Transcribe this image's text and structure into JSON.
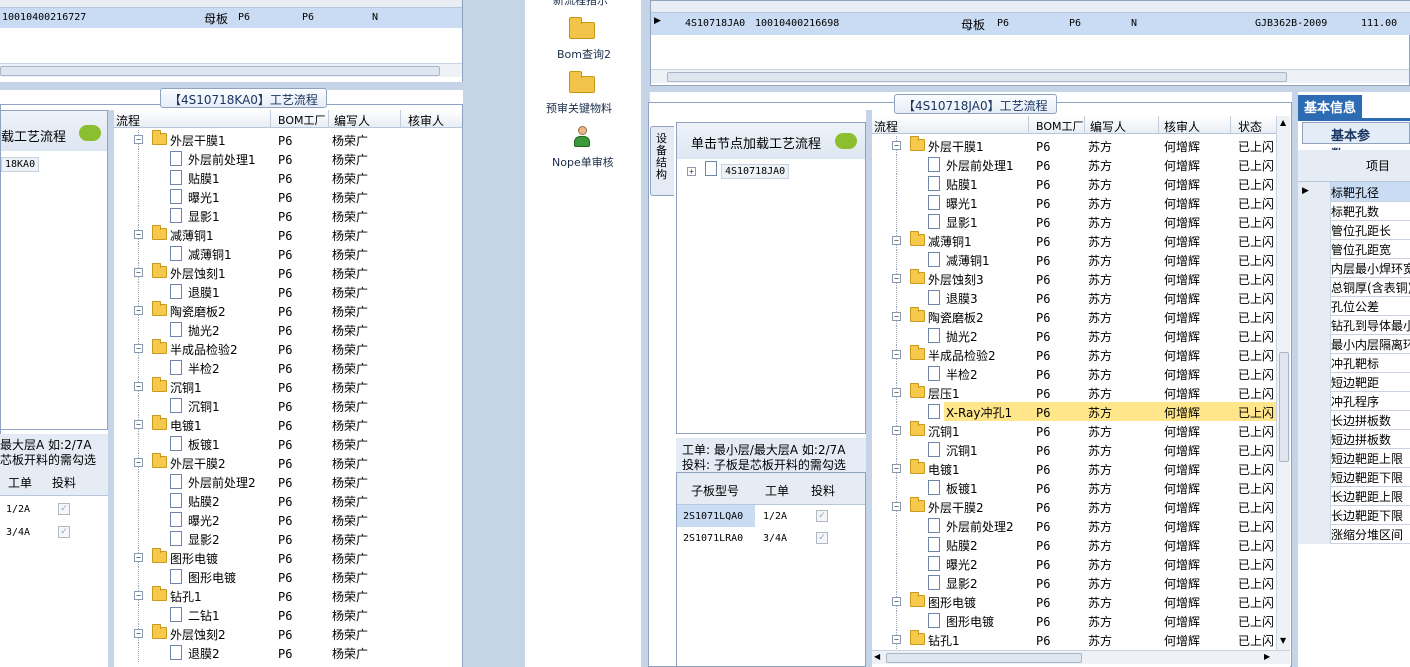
{
  "left_top_grid": {
    "row": {
      "code": "10010400216727",
      "type": "母板",
      "factory": "P6",
      "layer": "P6",
      "flag": "N"
    }
  },
  "left_proc": {
    "title": "【4S10718KA0】工艺流程",
    "side_title": "载工艺流程",
    "side_node": "18KA0",
    "note_line1": "最大层A 如:2/7A",
    "note_line2": "芯板开料的需勾选",
    "mini_headers": [
      "工单",
      "投料"
    ],
    "mini_rows": [
      {
        "order": "1/2A"
      },
      {
        "order": "3/4A"
      }
    ],
    "headers": [
      "流程",
      "BOM工厂",
      "编写人",
      "核审人"
    ],
    "rows": [
      {
        "kind": "folder",
        "label": "外层干膜1",
        "factory": "P6",
        "author": "杨荣广"
      },
      {
        "kind": "doc",
        "label": "外层前处理1",
        "factory": "P6",
        "author": "杨荣广"
      },
      {
        "kind": "doc",
        "label": "贴膜1",
        "factory": "P6",
        "author": "杨荣广"
      },
      {
        "kind": "doc",
        "label": "曝光1",
        "factory": "P6",
        "author": "杨荣广"
      },
      {
        "kind": "doc",
        "label": "显影1",
        "factory": "P6",
        "author": "杨荣广"
      },
      {
        "kind": "folder",
        "label": "减薄铜1",
        "factory": "P6",
        "author": "杨荣广"
      },
      {
        "kind": "doc",
        "label": "减薄铜1",
        "factory": "P6",
        "author": "杨荣广"
      },
      {
        "kind": "folder",
        "label": "外层蚀刻1",
        "factory": "P6",
        "author": "杨荣广"
      },
      {
        "kind": "doc",
        "label": "退膜1",
        "factory": "P6",
        "author": "杨荣广"
      },
      {
        "kind": "folder",
        "label": "陶瓷磨板2",
        "factory": "P6",
        "author": "杨荣广"
      },
      {
        "kind": "doc",
        "label": "抛光2",
        "factory": "P6",
        "author": "杨荣广"
      },
      {
        "kind": "folder",
        "label": "半成品检验2",
        "factory": "P6",
        "author": "杨荣广"
      },
      {
        "kind": "doc",
        "label": "半检2",
        "factory": "P6",
        "author": "杨荣广"
      },
      {
        "kind": "folder",
        "label": "沉铜1",
        "factory": "P6",
        "author": "杨荣广"
      },
      {
        "kind": "doc",
        "label": "沉铜1",
        "factory": "P6",
        "author": "杨荣广"
      },
      {
        "kind": "folder",
        "label": "电镀1",
        "factory": "P6",
        "author": "杨荣广"
      },
      {
        "kind": "doc",
        "label": "板镀1",
        "factory": "P6",
        "author": "杨荣广"
      },
      {
        "kind": "folder",
        "label": "外层干膜2",
        "factory": "P6",
        "author": "杨荣广"
      },
      {
        "kind": "doc",
        "label": "外层前处理2",
        "factory": "P6",
        "author": "杨荣广"
      },
      {
        "kind": "doc",
        "label": "贴膜2",
        "factory": "P6",
        "author": "杨荣广"
      },
      {
        "kind": "doc",
        "label": "曝光2",
        "factory": "P6",
        "author": "杨荣广"
      },
      {
        "kind": "doc",
        "label": "显影2",
        "factory": "P6",
        "author": "杨荣广"
      },
      {
        "kind": "folder",
        "label": "图形电镀",
        "factory": "P6",
        "author": "杨荣广"
      },
      {
        "kind": "doc",
        "label": "图形电镀",
        "factory": "P6",
        "author": "杨荣广"
      },
      {
        "kind": "folder",
        "label": "钻孔1",
        "factory": "P6",
        "author": "杨荣广"
      },
      {
        "kind": "doc",
        "label": "二钻1",
        "factory": "P6",
        "author": "杨荣广"
      },
      {
        "kind": "folder",
        "label": "外层蚀刻2",
        "factory": "P6",
        "author": "杨荣广"
      },
      {
        "kind": "doc",
        "label": "退膜2",
        "factory": "P6",
        "author": "杨荣广"
      }
    ]
  },
  "launcher": {
    "items": [
      {
        "label": "新流程指示",
        "icon": "folder-icon"
      },
      {
        "label": "Bom查询2",
        "icon": "folder-icon"
      },
      {
        "label": "预审关键物料",
        "icon": "folder-icon"
      },
      {
        "label": "Nope单审核",
        "icon": "user-icon"
      }
    ]
  },
  "right_top_grid": {
    "row": {
      "code": "4S10718JA0",
      "num": "10010400216698",
      "type": "母板",
      "factory": "P6",
      "layer": "P6",
      "flag": "N",
      "standard": "GJB362B-2009",
      "value": "111.00"
    }
  },
  "right_proc": {
    "title": "【4S10718JA0】工艺流程",
    "vertical_tab": "设备结构",
    "side_title": "单击节点加载工艺流程",
    "side_node": "4S10718JA0",
    "note_line1": "工单: 最小层/最大层A 如:2/7A",
    "note_line2": "投料: 子板是芯板开料的需勾选",
    "mini_headers": [
      "子板型号",
      "工单",
      "投料"
    ],
    "mini_rows": [
      {
        "model": "2S1071LQA0",
        "order": "1/2A"
      },
      {
        "model": "2S1071LRA0",
        "order": "3/4A"
      }
    ],
    "headers": [
      "流程",
      "BOM工厂",
      "编写人",
      "核审人",
      "状态"
    ],
    "rows": [
      {
        "kind": "folder",
        "label": "外层干膜1",
        "factory": "P6",
        "author": "苏方",
        "reviewer": "何增辉",
        "status": "已上闪"
      },
      {
        "kind": "doc",
        "label": "外层前处理1",
        "factory": "P6",
        "author": "苏方",
        "reviewer": "何增辉",
        "status": "已上闪"
      },
      {
        "kind": "doc",
        "label": "贴膜1",
        "factory": "P6",
        "author": "苏方",
        "reviewer": "何增辉",
        "status": "已上闪"
      },
      {
        "kind": "doc",
        "label": "曝光1",
        "factory": "P6",
        "author": "苏方",
        "reviewer": "何增辉",
        "status": "已上闪"
      },
      {
        "kind": "doc",
        "label": "显影1",
        "factory": "P6",
        "author": "苏方",
        "reviewer": "何增辉",
        "status": "已上闪"
      },
      {
        "kind": "folder",
        "label": "减薄铜1",
        "factory": "P6",
        "author": "苏方",
        "reviewer": "何增辉",
        "status": "已上闪"
      },
      {
        "kind": "doc",
        "label": "减薄铜1",
        "factory": "P6",
        "author": "苏方",
        "reviewer": "何增辉",
        "status": "已上闪"
      },
      {
        "kind": "folder",
        "label": "外层蚀刻3",
        "factory": "P6",
        "author": "苏方",
        "reviewer": "何增辉",
        "status": "已上闪"
      },
      {
        "kind": "doc",
        "label": "退膜3",
        "factory": "P6",
        "author": "苏方",
        "reviewer": "何增辉",
        "status": "已上闪"
      },
      {
        "kind": "folder",
        "label": "陶瓷磨板2",
        "factory": "P6",
        "author": "苏方",
        "reviewer": "何增辉",
        "status": "已上闪"
      },
      {
        "kind": "doc",
        "label": "抛光2",
        "factory": "P6",
        "author": "苏方",
        "reviewer": "何增辉",
        "status": "已上闪"
      },
      {
        "kind": "folder",
        "label": "半成品检验2",
        "factory": "P6",
        "author": "苏方",
        "reviewer": "何增辉",
        "status": "已上闪"
      },
      {
        "kind": "doc",
        "label": "半检2",
        "factory": "P6",
        "author": "苏方",
        "reviewer": "何增辉",
        "status": "已上闪"
      },
      {
        "kind": "folder",
        "label": "层压1",
        "factory": "P6",
        "author": "苏方",
        "reviewer": "何增辉",
        "status": "已上闪"
      },
      {
        "kind": "doc",
        "label": "X-Ray冲孔1",
        "factory": "P6",
        "author": "苏方",
        "reviewer": "何增辉",
        "status": "已上闪",
        "selected": true
      },
      {
        "kind": "folder",
        "label": "沉铜1",
        "factory": "P6",
        "author": "苏方",
        "reviewer": "何增辉",
        "status": "已上闪"
      },
      {
        "kind": "doc",
        "label": "沉铜1",
        "factory": "P6",
        "author": "苏方",
        "reviewer": "何增辉",
        "status": "已上闪"
      },
      {
        "kind": "folder",
        "label": "电镀1",
        "factory": "P6",
        "author": "苏方",
        "reviewer": "何增辉",
        "status": "已上闪"
      },
      {
        "kind": "doc",
        "label": "板镀1",
        "factory": "P6",
        "author": "苏方",
        "reviewer": "何增辉",
        "status": "已上闪"
      },
      {
        "kind": "folder",
        "label": "外层干膜2",
        "factory": "P6",
        "author": "苏方",
        "reviewer": "何增辉",
        "status": "已上闪"
      },
      {
        "kind": "doc",
        "label": "外层前处理2",
        "factory": "P6",
        "author": "苏方",
        "reviewer": "何增辉",
        "status": "已上闪"
      },
      {
        "kind": "doc",
        "label": "贴膜2",
        "factory": "P6",
        "author": "苏方",
        "reviewer": "何增辉",
        "status": "已上闪"
      },
      {
        "kind": "doc",
        "label": "曝光2",
        "factory": "P6",
        "author": "苏方",
        "reviewer": "何增辉",
        "status": "已上闪"
      },
      {
        "kind": "doc",
        "label": "显影2",
        "factory": "P6",
        "author": "苏方",
        "reviewer": "何增辉",
        "status": "已上闪"
      },
      {
        "kind": "folder",
        "label": "图形电镀",
        "factory": "P6",
        "author": "苏方",
        "reviewer": "何增辉",
        "status": "已上闪"
      },
      {
        "kind": "doc",
        "label": "图形电镀",
        "factory": "P6",
        "author": "苏方",
        "reviewer": "何增辉",
        "status": "已上闪"
      },
      {
        "kind": "folder",
        "label": "钻孔1",
        "factory": "P6",
        "author": "苏方",
        "reviewer": "何增辉",
        "status": "已上闪"
      }
    ]
  },
  "basic_info": {
    "tab": "基本信息",
    "subtab": "基本参数",
    "column": "项目",
    "items": [
      "标靶孔径",
      "标靶孔数",
      "管位孔距长",
      "管位孔距宽",
      "内层最小焊环宽",
      "总铜厚(含表铜)",
      "孔位公差",
      "钻孔到导体最小",
      "最小内层隔离环",
      "冲孔靶标",
      "短边靶距",
      "冲孔程序",
      "长边拼板数",
      "短边拼板数",
      "短边靶距上限",
      "短边靶距下限",
      "长边靶距上限",
      "长边靶距下限",
      "涨缩分堆区间"
    ]
  },
  "colors": {
    "selection": "#c9dcf3",
    "highlight": "#ffe68a",
    "tab_blue": "#2d6bb3"
  }
}
